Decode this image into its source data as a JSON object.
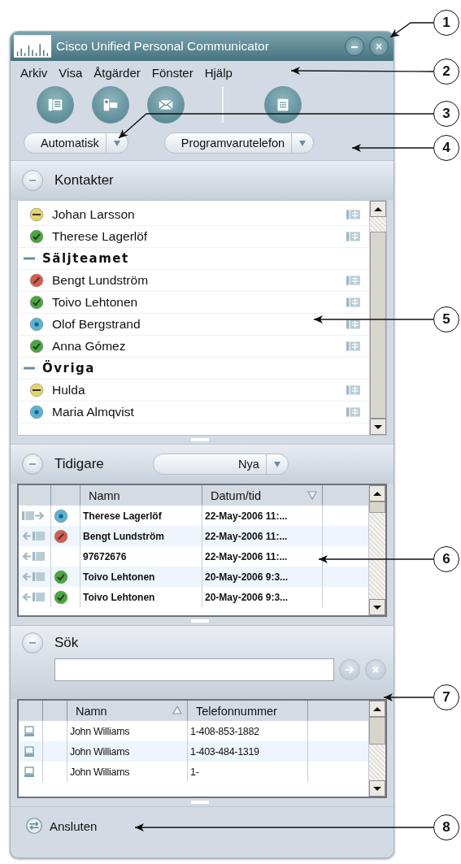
{
  "window": {
    "title": "Cisco Unified Personal Communicator"
  },
  "menu": [
    "Arkiv",
    "Visa",
    "Åtgärder",
    "Fönster",
    "Hjälp"
  ],
  "status_dropdown": {
    "value": "Automatisk"
  },
  "phone_dropdown": {
    "value": "Programvarutelefon"
  },
  "contacts": {
    "title": "Kontakter",
    "expanded": true,
    "items": [
      {
        "name": "Johan Larsson",
        "presence": {
          "kind": "away"
        }
      },
      {
        "name": "Therese Lagerlöf",
        "presence": {
          "kind": "available"
        }
      }
    ],
    "groups": [
      {
        "name": "Säljteamet",
        "expanded": true,
        "children": [
          {
            "name": "Bengt Lundström",
            "presence": {
              "kind": "busy"
            }
          },
          {
            "name": "Toivo Lehtonen",
            "presence": {
              "kind": "available"
            }
          },
          {
            "name": "Olof Bergstrand",
            "presence": {
              "kind": "idle"
            }
          },
          {
            "name": "Anna Gómez",
            "presence": {
              "kind": "available"
            }
          }
        ]
      },
      {
        "name": "Övriga",
        "expanded": true,
        "children": [
          {
            "name": "Hulda",
            "presence": {
              "kind": "away"
            }
          },
          {
            "name": "Maria Almqvist",
            "presence": {
              "kind": "idle"
            }
          }
        ]
      }
    ]
  },
  "history": {
    "title": "Tidigare",
    "expanded": true,
    "filter": "Nya",
    "columns": [
      {
        "label": "Namn"
      },
      {
        "label": "Datum/tid",
        "sort": {
          "kind": "descending"
        }
      }
    ],
    "rows": [
      {
        "outgoing": true,
        "presence": {
          "kind": "idle"
        },
        "name": "Therese Lagerlöf",
        "time": "22-May-2006 11:..."
      },
      {
        "outgoing": false,
        "presence": {
          "kind": "busy"
        },
        "name": "Bengt Lundström",
        "time": "22-May-2006 11:..."
      },
      {
        "outgoing": false,
        "name": "97672676",
        "time": "22-May-2006 11:..."
      },
      {
        "outgoing": false,
        "presence": {
          "kind": "available"
        },
        "name": "Toivo Lehtonen",
        "time": "20-May-2006 9:3..."
      },
      {
        "outgoing": false,
        "presence": {
          "kind": "available"
        },
        "name": "Toivo Lehtonen",
        "time": "20-May-2006 9:3..."
      }
    ]
  },
  "search": {
    "title": "Sök",
    "expanded": true,
    "columns": [
      {
        "label": "Namn",
        "sort": {
          "kind": "ascending"
        }
      },
      {
        "label": "Telefonnummer"
      }
    ],
    "rows": [
      {
        "name": "John Williams",
        "phone": "1-408-853-1882"
      },
      {
        "name": "John Williams",
        "phone": "1-403-484-1319"
      },
      {
        "name": "John Williams",
        "phone": "1-"
      }
    ]
  },
  "status_bar": {
    "text": "Ansluten"
  },
  "callouts": [
    "1",
    "2",
    "3",
    "4",
    "5",
    "6",
    "7",
    "8"
  ]
}
